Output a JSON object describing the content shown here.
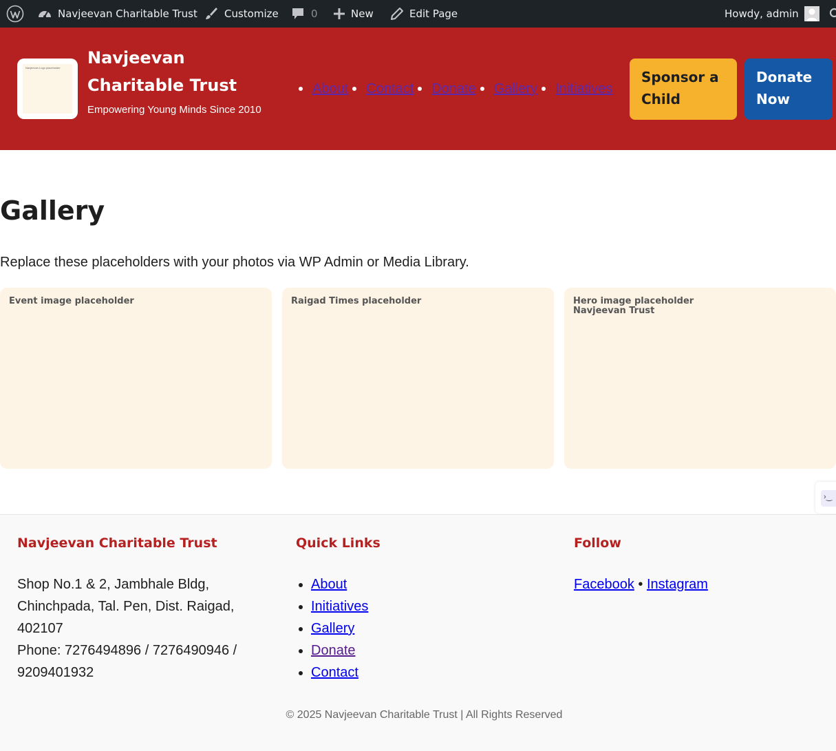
{
  "admin_bar": {
    "site_name": "Navjeevan Charitable Trust",
    "customize": "Customize",
    "comments_count": "0",
    "new": "New",
    "edit_page": "Edit Page",
    "howdy": "Howdy, admin"
  },
  "header": {
    "logo_text": "Navjeevan Logo placeholder",
    "title": "Navjeevan Charitable Trust",
    "tagline": "Empowering Young Minds Since 2010",
    "nav": [
      "About",
      "Contact",
      "Donate",
      "Gallery",
      "Initiatives"
    ],
    "sponsor_button": "Sponsor a Child",
    "donate_button": "Donate Now",
    "colors": {
      "header_bg": "#b52020",
      "sponsor_bg": "#f6b12d",
      "donate_bg": "#1558a6"
    }
  },
  "main": {
    "title": "Gallery",
    "intro": "Replace these placeholders with your photos via WP Admin or Media Library.",
    "cards": [
      {
        "label": "Event image placeholder"
      },
      {
        "label": "Raigad Times placeholder"
      },
      {
        "label": "Hero image placeholder\nNavjeevan Trust"
      }
    ]
  },
  "footer": {
    "org_heading": "Navjeevan Charitable Trust",
    "address": "Shop No.1 & 2, Jambhale Bldg, Chinchpada, Tal. Pen, Dist. Raigad, 402107",
    "phone": "Phone: 7276494896 / 7276490946 / 9209401932",
    "quick_links_heading": "Quick Links",
    "quick_links": [
      "About",
      "Initiatives",
      "Gallery",
      "Donate",
      "Contact"
    ],
    "follow_heading": "Follow",
    "facebook": "Facebook",
    "separator": "•",
    "instagram": "Instagram",
    "copyright": "© 2025 Navjeevan Charitable Trust | All Rights Reserved"
  }
}
